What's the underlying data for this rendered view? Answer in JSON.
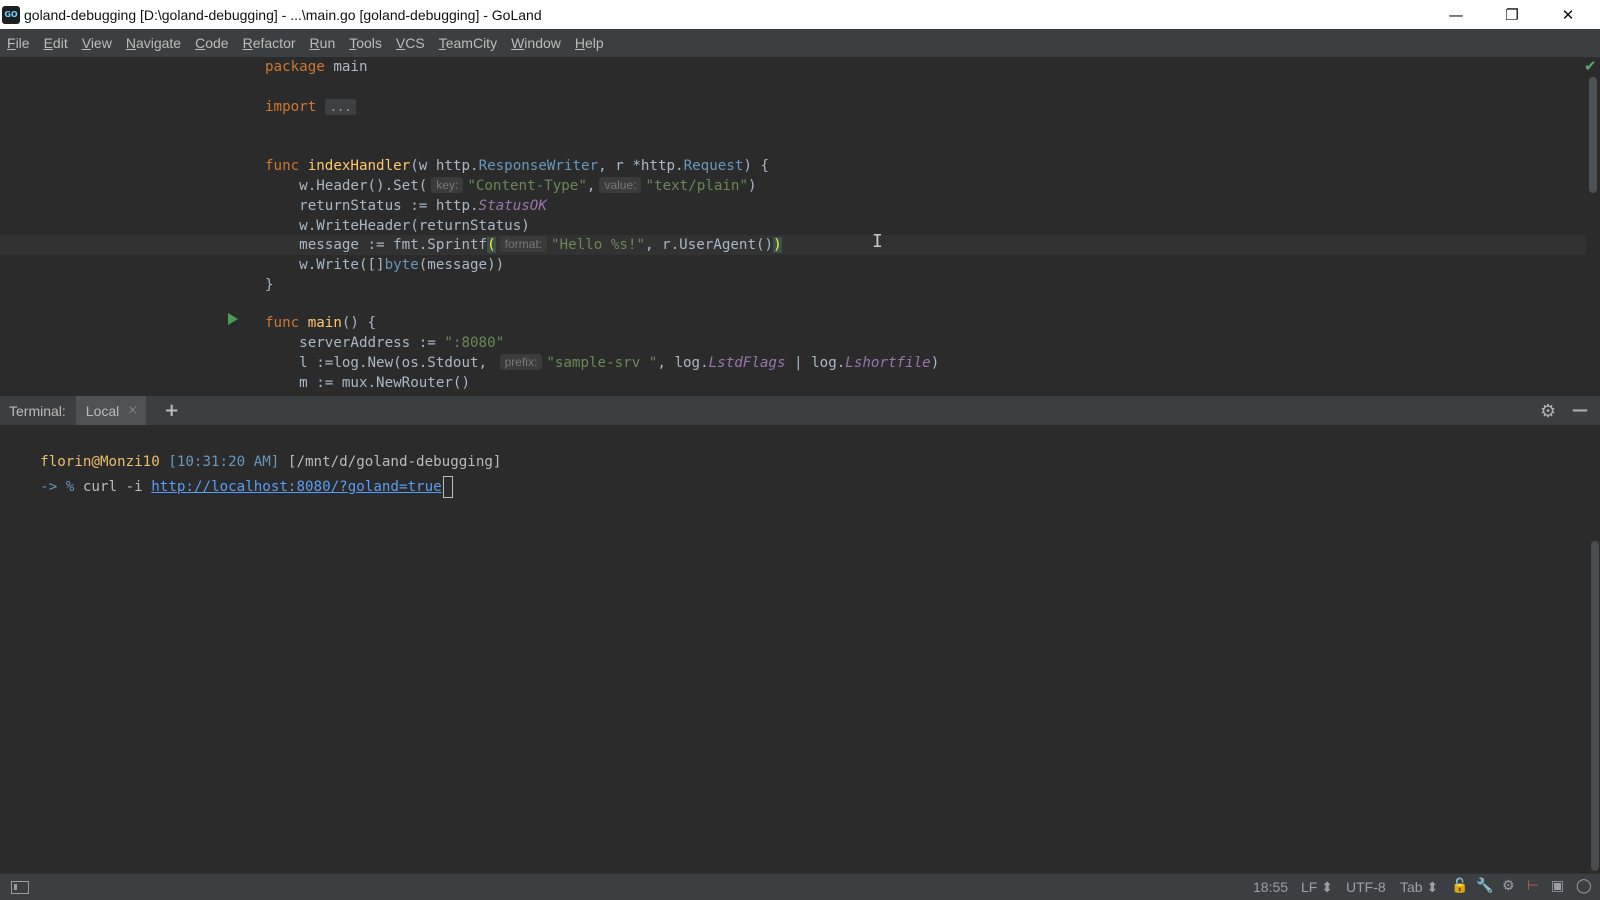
{
  "window": {
    "title": "goland-debugging [D:\\goland-debugging] - ...\\main.go [goland-debugging] - GoLand",
    "logo_text": "GO",
    "controls": {
      "minimize": "—",
      "restore": "❐",
      "close": "✕"
    }
  },
  "menu": [
    "File",
    "Edit",
    "View",
    "Navigate",
    "Code",
    "Refactor",
    "Run",
    "Tools",
    "VCS",
    "TeamCity",
    "Window",
    "Help"
  ],
  "editor": {
    "lines": {
      "package": {
        "kw": "package",
        "name": " main"
      },
      "import": {
        "kw": "import",
        "fold": "..."
      },
      "func1": {
        "kw": "func ",
        "name": "indexHandler",
        "p1": "(w http.",
        "t1": "ResponseWriter",
        "p2": ", r *http.",
        "t2": "Request",
        "p3": ") {"
      },
      "header": {
        "pre": "    w.Header().Set(",
        "hint_key": "key:",
        "str_key": "\"Content-Type\"",
        "comma": ",",
        "hint_value": "value:",
        "str_value": "\"text/plain\"",
        "end": ")"
      },
      "status": {
        "pre": "    returnStatus := http.",
        "const": "StatusOK"
      },
      "writeheader": {
        "text": "    w.WriteHeader(returnStatus)"
      },
      "message": {
        "pre": "    message := fmt.Sprintf",
        "open": "(",
        "hint_format": "format:",
        "str": "\"Hello %s!\"",
        "mid": ", r.UserAgent()",
        "close": ")"
      },
      "write": {
        "pre": "    w.Write([]",
        "typ": "byte",
        "end": "(message))"
      },
      "brace": {
        "text": "}"
      },
      "func2": {
        "kw": "func ",
        "name": "main",
        "end": "() {"
      },
      "server": {
        "pre": "    serverAddress := ",
        "str": "\":8080\""
      },
      "logger": {
        "pre": "    l :=log.New(os.Stdout, ",
        "hint_prefix": "prefix:",
        "str": "\"sample-srv \"",
        "mid": ", log.",
        "c1": "LstdFlags",
        "mid2": " | log.",
        "c2": "Lshortfile",
        "end": ")"
      },
      "router": {
        "text": "    m := mux.NewRouter()"
      }
    },
    "inspection_status": "✔",
    "cursor_glyph": "I"
  },
  "terminal": {
    "label": "Terminal:",
    "tab": "Local",
    "tab_close": "×",
    "add": "+",
    "gear": "⚙",
    "minimize": "—",
    "prompt_user": "florin@Monzi10",
    "prompt_time": "[10:31:20 AM]",
    "prompt_path": "[/mnt/d/goland-debugging]",
    "arrow": "-> %",
    "command": "curl -i ",
    "url": "http://localhost:8080/?goland=true"
  },
  "statusbar": {
    "position": "18:55",
    "line_separator": "LF ⬍",
    "encoding": "UTF-8",
    "indent": "Tab ⬍",
    "icons": [
      "lock-icon",
      "wrench-icon",
      "cog-icon",
      "vcs-icon",
      "memory-icon",
      "notifications-icon"
    ],
    "lock": "🔓",
    "wrench": "🔧",
    "cog": "⚙",
    "vcs": "⊢",
    "memory": "▣",
    "notifications": "◯"
  }
}
